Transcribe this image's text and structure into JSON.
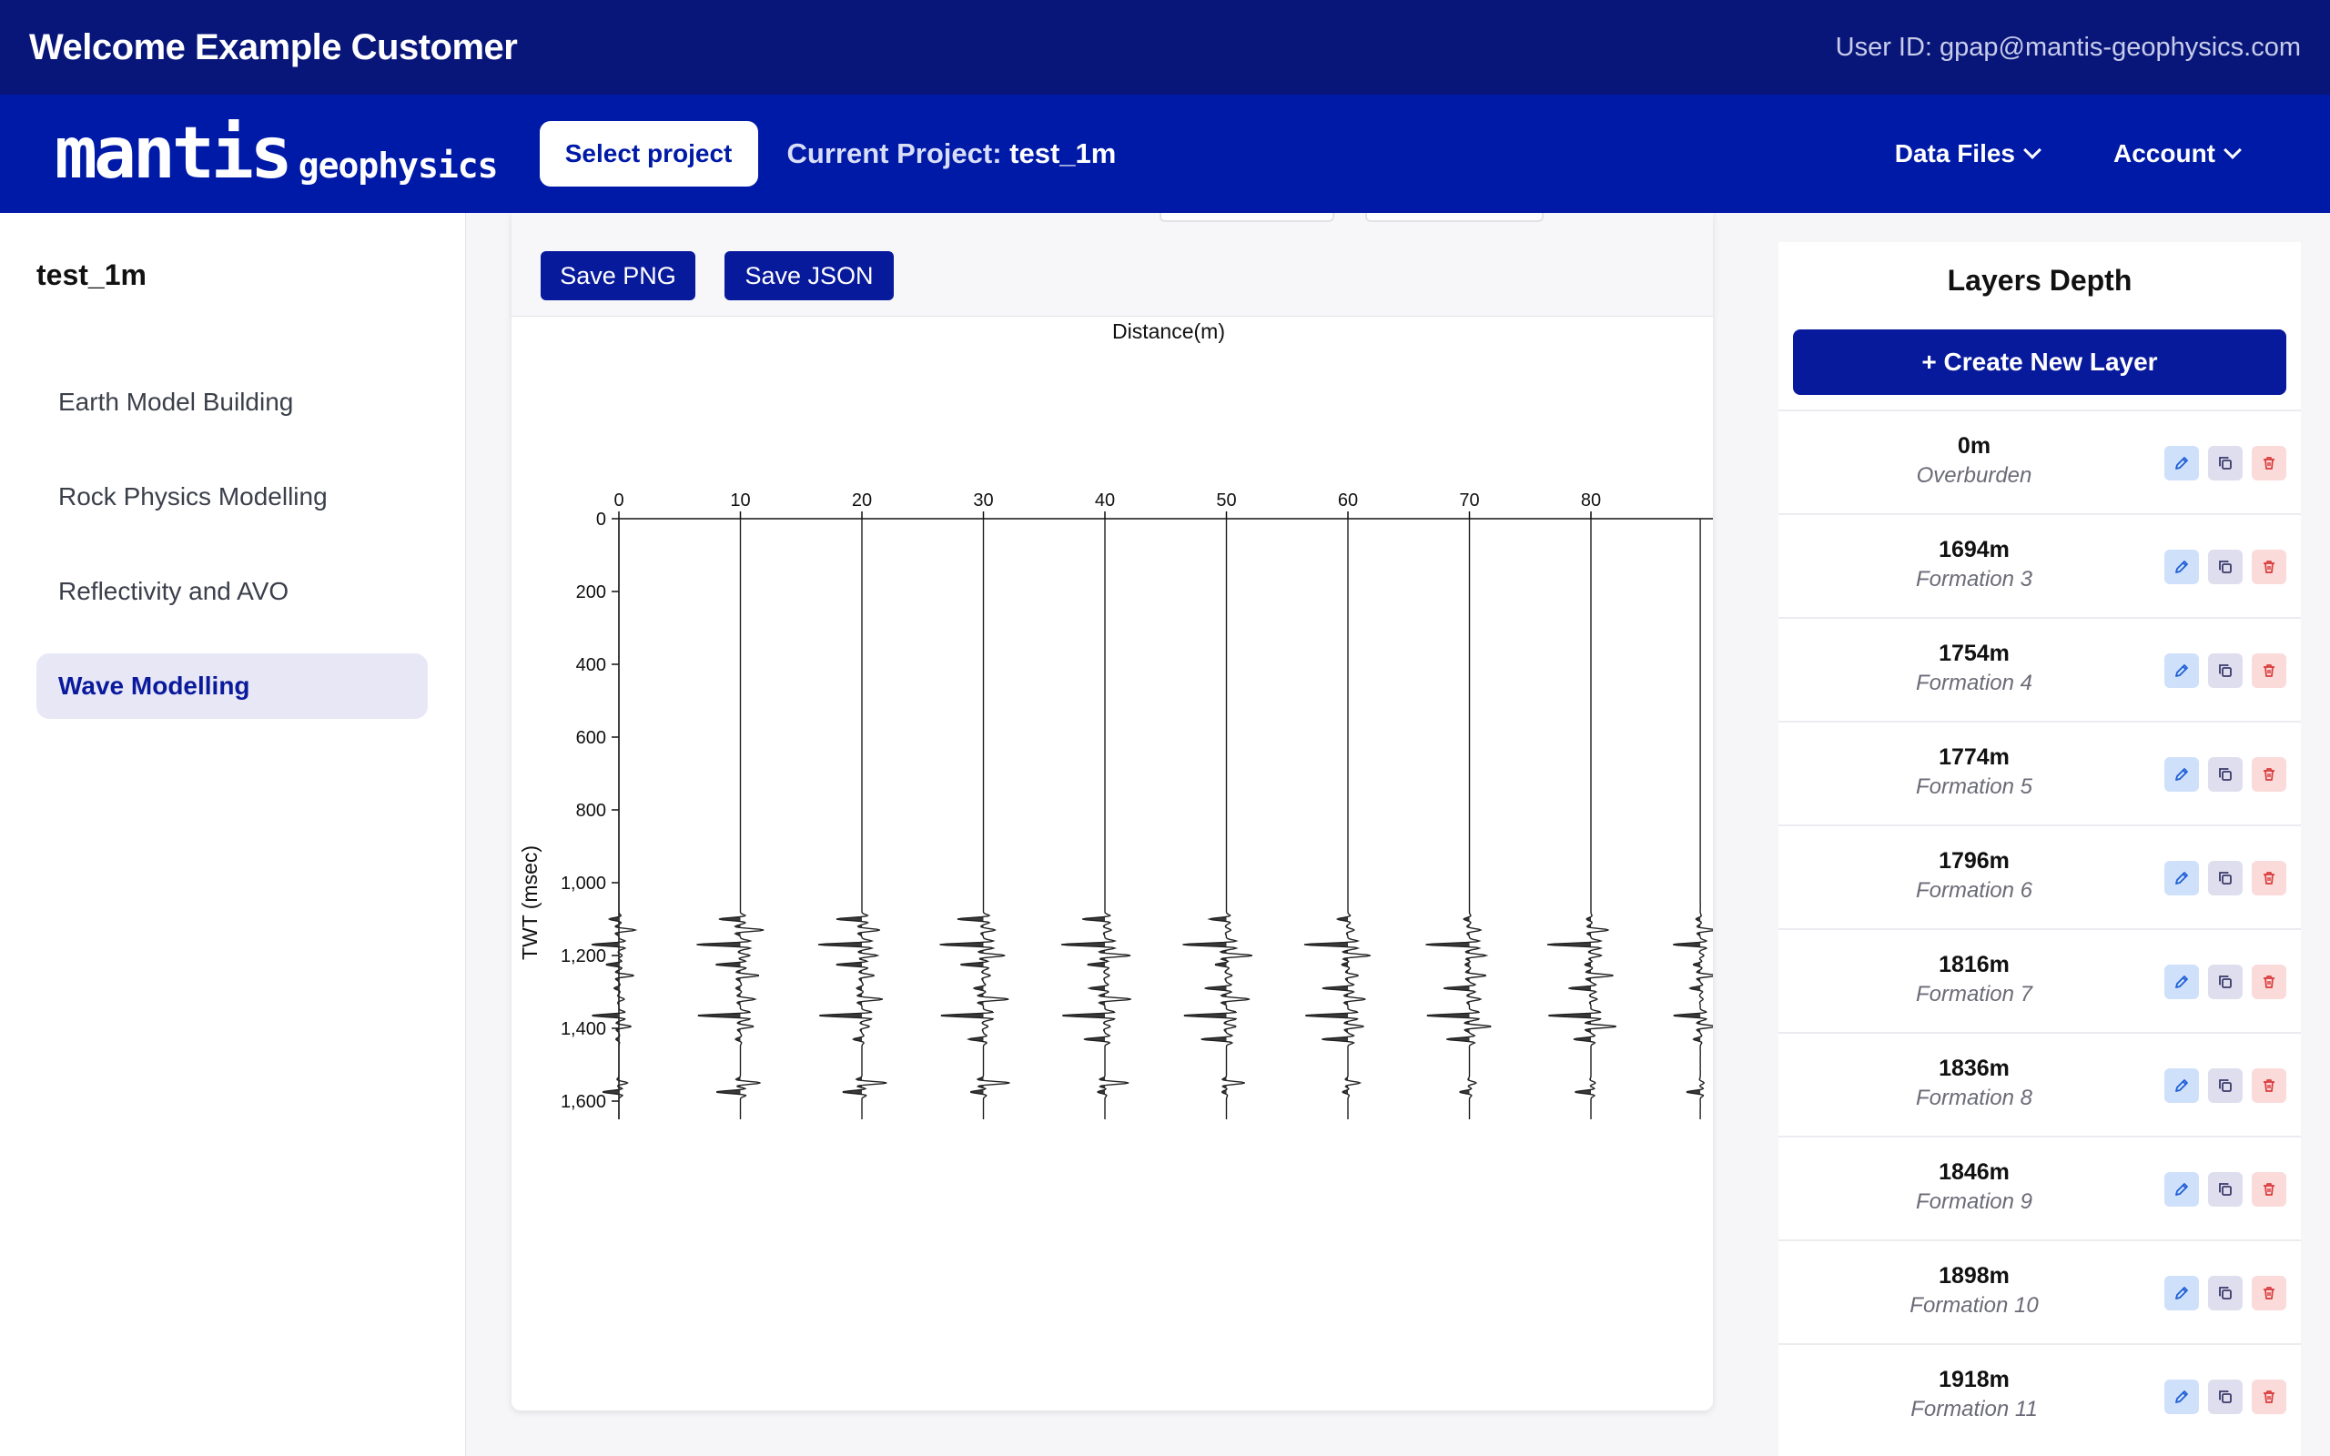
{
  "header": {
    "welcome": "Welcome Example Customer",
    "user_id": "User ID: gpap@mantis-geophysics.com"
  },
  "navbar": {
    "logo_main": "mantis",
    "logo_sub": "geophysics",
    "select_project": "Select project",
    "current_project_label": "Current Project:",
    "current_project_value": "test_1m",
    "menus": [
      {
        "label": "Data Files",
        "icon": "chevron-down-icon"
      },
      {
        "label": "Account",
        "icon": "chevron-down-icon"
      }
    ]
  },
  "sidebar": {
    "project": "test_1m",
    "items": [
      {
        "label": "Earth Model Building",
        "active": false
      },
      {
        "label": "Rock Physics Modelling",
        "active": false
      },
      {
        "label": "Reflectivity and AVO",
        "active": false
      },
      {
        "label": "Wave Modelling",
        "active": true
      }
    ]
  },
  "toolbar": {
    "save_png": "Save PNG",
    "save_json": "Save JSON"
  },
  "chart_data": {
    "type": "seismic-wiggle",
    "xlabel": "Distance(m)",
    "ylabel": "TWT (msec)",
    "x_ticks": [
      0,
      10,
      20,
      30,
      40,
      50,
      60,
      70,
      80
    ],
    "y_ticks": [
      "0",
      "200",
      "400",
      "600",
      "800",
      "1,000",
      "1,200",
      "1,400",
      "1,600"
    ],
    "xlim": [
      0,
      89
    ],
    "ylim": [
      0,
      1650
    ],
    "traces_x": [
      0,
      10,
      20,
      30,
      40,
      50,
      60,
      70,
      80,
      89
    ],
    "reflection_times": [
      1100,
      1130,
      1170,
      1200,
      1225,
      1255,
      1290,
      1320,
      1365,
      1395,
      1430,
      1550,
      1575
    ]
  },
  "layers": {
    "title": "Layers Depth",
    "create_label": "+ Create New Layer",
    "items": [
      {
        "depth": "0m",
        "name": "Overburden"
      },
      {
        "depth": "1694m",
        "name": "Formation 3"
      },
      {
        "depth": "1754m",
        "name": "Formation 4"
      },
      {
        "depth": "1774m",
        "name": "Formation 5"
      },
      {
        "depth": "1796m",
        "name": "Formation 6"
      },
      {
        "depth": "1816m",
        "name": "Formation 7"
      },
      {
        "depth": "1836m",
        "name": "Formation 8"
      },
      {
        "depth": "1846m",
        "name": "Formation 9"
      },
      {
        "depth": "1898m",
        "name": "Formation 10"
      },
      {
        "depth": "1918m",
        "name": "Formation 11"
      }
    ],
    "action_icons": [
      "pencil-icon",
      "copy-icon",
      "trash-icon"
    ],
    "colors": {
      "edit": "#1f5fd6",
      "copy": "#3a3a6a",
      "delete": "#d93a3a"
    }
  },
  "colors": {
    "topbar": "#08167a",
    "navbar": "#001aa8",
    "accent": "#081a9c"
  }
}
